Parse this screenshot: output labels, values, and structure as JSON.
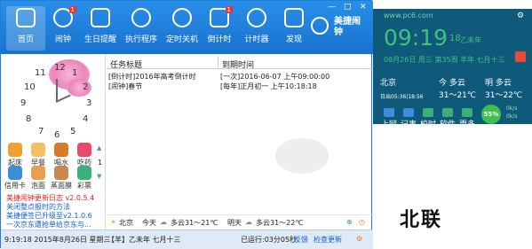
{
  "toolbar": {
    "buttons": [
      {
        "label": "首页",
        "icon": "home-icon",
        "active": true
      },
      {
        "label": "闹钟",
        "icon": "alarm-clock-icon",
        "badge": "1"
      },
      {
        "label": "生日提醒",
        "icon": "cake-icon"
      },
      {
        "label": "执行程序",
        "icon": "gear-icon"
      },
      {
        "label": "定时关机",
        "icon": "power-icon"
      },
      {
        "label": "倒计时",
        "icon": "hourglass-icon",
        "badge": "1"
      },
      {
        "label": "计时器",
        "icon": "stopwatch-icon"
      },
      {
        "label": "发现",
        "icon": "discover-icon"
      }
    ],
    "brand": "美捷闹钟",
    "window_controls": [
      "—",
      "□",
      "✕"
    ]
  },
  "clock": {
    "numbers": [
      "12",
      "1",
      "2",
      "3",
      "4",
      "5",
      "6",
      "7",
      "8",
      "9",
      "10",
      "11"
    ]
  },
  "tools": [
    {
      "label": "起床",
      "icon": "sun-icon",
      "color": "#f0a030"
    },
    {
      "label": "早餐",
      "icon": "breakfast-icon",
      "color": "#f5c060"
    },
    {
      "label": "喝水",
      "icon": "cup-icon",
      "color": "#d87a2a"
    },
    {
      "label": "吃药",
      "icon": "pill-icon",
      "color": "#e84a6a"
    },
    {
      "label": "信用卡",
      "icon": "card-icon",
      "color": "#3a8fd8"
    },
    {
      "label": "泡面",
      "icon": "noodles-icon",
      "color": "#e8a050"
    },
    {
      "label": "蒸面膜",
      "icon": "mask-icon",
      "color": "#c88a4a"
    },
    {
      "label": "彩票",
      "icon": "lottery-icon",
      "color": "#3ab07a"
    }
  ],
  "pager": {
    "up": "▲",
    "page": "1",
    "down": "▼"
  },
  "news": [
    {
      "text": "美捷闹钟更新日志 v2.0.5.4",
      "color": "#e02020"
    },
    {
      "text": "关闭整点报时的方法",
      "color": "#1060c8"
    },
    {
      "text": "美捷便签已升级至v2.1.0.6",
      "color": "#1060c8"
    },
    {
      "text": "一次京东遭抢单给京东与...",
      "color": "#1060c8"
    }
  ],
  "list": {
    "headers": [
      "任务标题",
      "到期时间"
    ],
    "rows": [
      {
        "title": "[倒计时]2016年高考倒计时",
        "due": "[一次]2016-06-07  上午09:00:00"
      },
      {
        "title": "[闹钟]春节",
        "due": "[每年]正月初一  上午10:18:18"
      }
    ]
  },
  "weather_bar": {
    "city": "北京",
    "today_label": "今天",
    "today": "多云31～21℃",
    "tomorrow_label": "明天",
    "tomorrow": "多云31～22℃"
  },
  "status": {
    "datetime": "9:19:18  2015年8月26日  星期三",
    "lunar": "【羊】乙未年 七月十三",
    "runtime": "已运行:03分05秒",
    "feedback": "反馈",
    "update": "检查更新"
  },
  "widget": {
    "url": "www.pc6.com",
    "time": "09:19",
    "seconds": "18",
    "date": "08月26日 周三 第35周",
    "lunar1": "乙未年",
    "lunar2": "羊年 七月十三",
    "city": "北京",
    "sunrise": "日出05:36|18:56",
    "today_label": "今 多云",
    "today_temp": "31～21℃",
    "tomorrow_label": "明 多云",
    "tomorrow_temp": "31～22℃",
    "buttons": [
      "上网",
      "记事",
      "校时",
      "软件",
      "更多"
    ],
    "speed": "55%",
    "net_up": "0k/s",
    "net_down": "0k/s"
  },
  "watermark": "北联"
}
